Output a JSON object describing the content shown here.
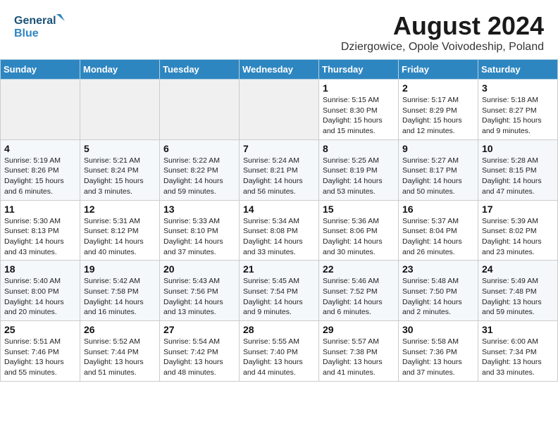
{
  "header": {
    "logo_general": "General",
    "logo_blue": "Blue",
    "month": "August 2024",
    "location": "Dziergowice, Opole Voivodeship, Poland"
  },
  "weekdays": [
    "Sunday",
    "Monday",
    "Tuesday",
    "Wednesday",
    "Thursday",
    "Friday",
    "Saturday"
  ],
  "weeks": [
    [
      {
        "day": "",
        "info": ""
      },
      {
        "day": "",
        "info": ""
      },
      {
        "day": "",
        "info": ""
      },
      {
        "day": "",
        "info": ""
      },
      {
        "day": "1",
        "info": "Sunrise: 5:15 AM\nSunset: 8:30 PM\nDaylight: 15 hours\nand 15 minutes."
      },
      {
        "day": "2",
        "info": "Sunrise: 5:17 AM\nSunset: 8:29 PM\nDaylight: 15 hours\nand 12 minutes."
      },
      {
        "day": "3",
        "info": "Sunrise: 5:18 AM\nSunset: 8:27 PM\nDaylight: 15 hours\nand 9 minutes."
      }
    ],
    [
      {
        "day": "4",
        "info": "Sunrise: 5:19 AM\nSunset: 8:26 PM\nDaylight: 15 hours\nand 6 minutes."
      },
      {
        "day": "5",
        "info": "Sunrise: 5:21 AM\nSunset: 8:24 PM\nDaylight: 15 hours\nand 3 minutes."
      },
      {
        "day": "6",
        "info": "Sunrise: 5:22 AM\nSunset: 8:22 PM\nDaylight: 14 hours\nand 59 minutes."
      },
      {
        "day": "7",
        "info": "Sunrise: 5:24 AM\nSunset: 8:21 PM\nDaylight: 14 hours\nand 56 minutes."
      },
      {
        "day": "8",
        "info": "Sunrise: 5:25 AM\nSunset: 8:19 PM\nDaylight: 14 hours\nand 53 minutes."
      },
      {
        "day": "9",
        "info": "Sunrise: 5:27 AM\nSunset: 8:17 PM\nDaylight: 14 hours\nand 50 minutes."
      },
      {
        "day": "10",
        "info": "Sunrise: 5:28 AM\nSunset: 8:15 PM\nDaylight: 14 hours\nand 47 minutes."
      }
    ],
    [
      {
        "day": "11",
        "info": "Sunrise: 5:30 AM\nSunset: 8:13 PM\nDaylight: 14 hours\nand 43 minutes."
      },
      {
        "day": "12",
        "info": "Sunrise: 5:31 AM\nSunset: 8:12 PM\nDaylight: 14 hours\nand 40 minutes."
      },
      {
        "day": "13",
        "info": "Sunrise: 5:33 AM\nSunset: 8:10 PM\nDaylight: 14 hours\nand 37 minutes."
      },
      {
        "day": "14",
        "info": "Sunrise: 5:34 AM\nSunset: 8:08 PM\nDaylight: 14 hours\nand 33 minutes."
      },
      {
        "day": "15",
        "info": "Sunrise: 5:36 AM\nSunset: 8:06 PM\nDaylight: 14 hours\nand 30 minutes."
      },
      {
        "day": "16",
        "info": "Sunrise: 5:37 AM\nSunset: 8:04 PM\nDaylight: 14 hours\nand 26 minutes."
      },
      {
        "day": "17",
        "info": "Sunrise: 5:39 AM\nSunset: 8:02 PM\nDaylight: 14 hours\nand 23 minutes."
      }
    ],
    [
      {
        "day": "18",
        "info": "Sunrise: 5:40 AM\nSunset: 8:00 PM\nDaylight: 14 hours\nand 20 minutes."
      },
      {
        "day": "19",
        "info": "Sunrise: 5:42 AM\nSunset: 7:58 PM\nDaylight: 14 hours\nand 16 minutes."
      },
      {
        "day": "20",
        "info": "Sunrise: 5:43 AM\nSunset: 7:56 PM\nDaylight: 14 hours\nand 13 minutes."
      },
      {
        "day": "21",
        "info": "Sunrise: 5:45 AM\nSunset: 7:54 PM\nDaylight: 14 hours\nand 9 minutes."
      },
      {
        "day": "22",
        "info": "Sunrise: 5:46 AM\nSunset: 7:52 PM\nDaylight: 14 hours\nand 6 minutes."
      },
      {
        "day": "23",
        "info": "Sunrise: 5:48 AM\nSunset: 7:50 PM\nDaylight: 14 hours\nand 2 minutes."
      },
      {
        "day": "24",
        "info": "Sunrise: 5:49 AM\nSunset: 7:48 PM\nDaylight: 13 hours\nand 59 minutes."
      }
    ],
    [
      {
        "day": "25",
        "info": "Sunrise: 5:51 AM\nSunset: 7:46 PM\nDaylight: 13 hours\nand 55 minutes."
      },
      {
        "day": "26",
        "info": "Sunrise: 5:52 AM\nSunset: 7:44 PM\nDaylight: 13 hours\nand 51 minutes."
      },
      {
        "day": "27",
        "info": "Sunrise: 5:54 AM\nSunset: 7:42 PM\nDaylight: 13 hours\nand 48 minutes."
      },
      {
        "day": "28",
        "info": "Sunrise: 5:55 AM\nSunset: 7:40 PM\nDaylight: 13 hours\nand 44 minutes."
      },
      {
        "day": "29",
        "info": "Sunrise: 5:57 AM\nSunset: 7:38 PM\nDaylight: 13 hours\nand 41 minutes."
      },
      {
        "day": "30",
        "info": "Sunrise: 5:58 AM\nSunset: 7:36 PM\nDaylight: 13 hours\nand 37 minutes."
      },
      {
        "day": "31",
        "info": "Sunrise: 6:00 AM\nSunset: 7:34 PM\nDaylight: 13 hours\nand 33 minutes."
      }
    ]
  ]
}
